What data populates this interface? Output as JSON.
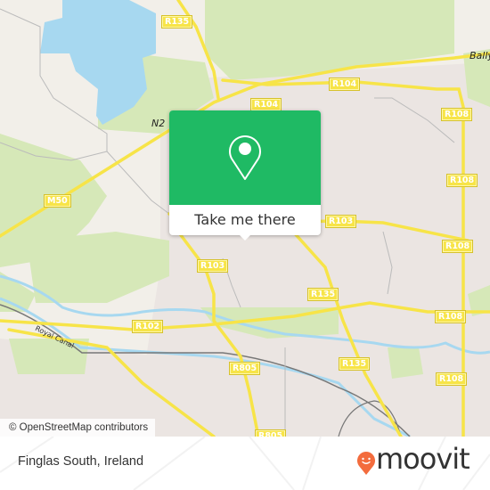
{
  "map": {
    "attribution": "© OpenStreetMap contributors",
    "colors": {
      "land": "#f2efe9",
      "residential": "#ebe5e2",
      "park": "#d6e8b8",
      "water": "#a7d8f0",
      "road_major": "#f7e448",
      "popup_green": "#1fba64",
      "brand_orange": "#f36c3d"
    },
    "road_labels": [
      {
        "id": "r135-top",
        "text": "R135"
      },
      {
        "id": "r104-a",
        "text": "R104"
      },
      {
        "id": "r104-b",
        "text": "R104"
      },
      {
        "id": "r108-a",
        "text": "R108"
      },
      {
        "id": "r108-b",
        "text": "R108"
      },
      {
        "id": "m50",
        "text": "M50"
      },
      {
        "id": "r103-a",
        "text": "R103"
      },
      {
        "id": "r103-b",
        "text": "R103"
      },
      {
        "id": "r108-c",
        "text": "R108"
      },
      {
        "id": "r135-mid",
        "text": "R135"
      },
      {
        "id": "r108-d",
        "text": "R108"
      },
      {
        "id": "r102",
        "text": "R102"
      },
      {
        "id": "r805",
        "text": "R805"
      },
      {
        "id": "r135-low",
        "text": "R135"
      },
      {
        "id": "r108-e",
        "text": "R108"
      },
      {
        "id": "r805-b",
        "text": "R805"
      }
    ],
    "place_labels": {
      "n2": "N2",
      "bally": "Bally",
      "royal_canal": "Royal Canal"
    }
  },
  "popup": {
    "icon": "location-pin-icon",
    "cta_label": "Take me there"
  },
  "footer": {
    "location": "Finglas South, Ireland",
    "brand": "moovit",
    "brand_icon": "moovit-smile-pin-icon"
  }
}
